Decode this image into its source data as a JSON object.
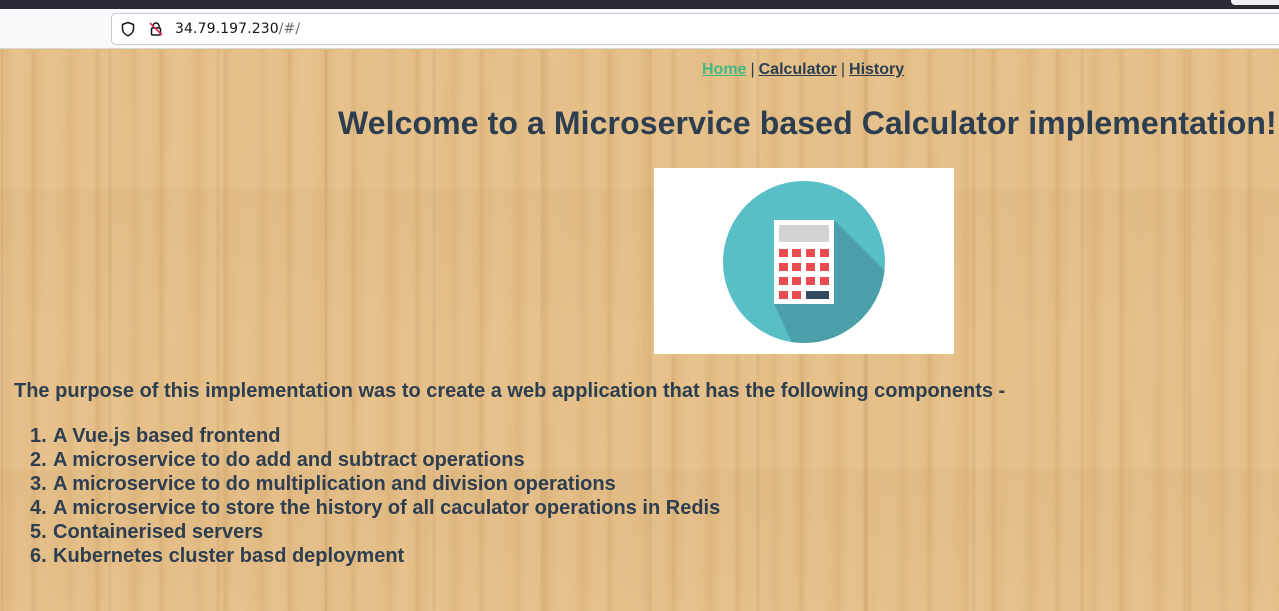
{
  "browser": {
    "url_host": "34.79.197.230",
    "url_path": "/#/"
  },
  "nav": {
    "links": [
      {
        "label": "Home",
        "active": true
      },
      {
        "label": "Calculator",
        "active": false
      },
      {
        "label": "History",
        "active": false
      }
    ],
    "separator": "|"
  },
  "main": {
    "title": "Welcome to a Microservice based Calculator implementation!",
    "logo_icon": "calculator-icon",
    "purpose": "The purpose of this implementation was to create a web application that has the following components -",
    "components": [
      {
        "num": "1.",
        "text": "A Vue.js based frontend"
      },
      {
        "num": "2.",
        "text": "A microservice to do add and subtract operations"
      },
      {
        "num": "3.",
        "text": "A microservice to do multiplication and division operations"
      },
      {
        "num": "4.",
        "text": "A microservice to store the history of all caculator operations in Redis"
      },
      {
        "num": "5.",
        "text": "Containerised servers"
      },
      {
        "num": "6.",
        "text": "Kubernetes cluster basd deployment"
      }
    ]
  },
  "colors": {
    "text": "#2c3e50",
    "active_link": "#42b983",
    "wood": "#e4bd85",
    "logo_circle": "#58bfc7",
    "logo_shadow": "#4a9fa8",
    "logo_keys": "#e84c4f"
  }
}
